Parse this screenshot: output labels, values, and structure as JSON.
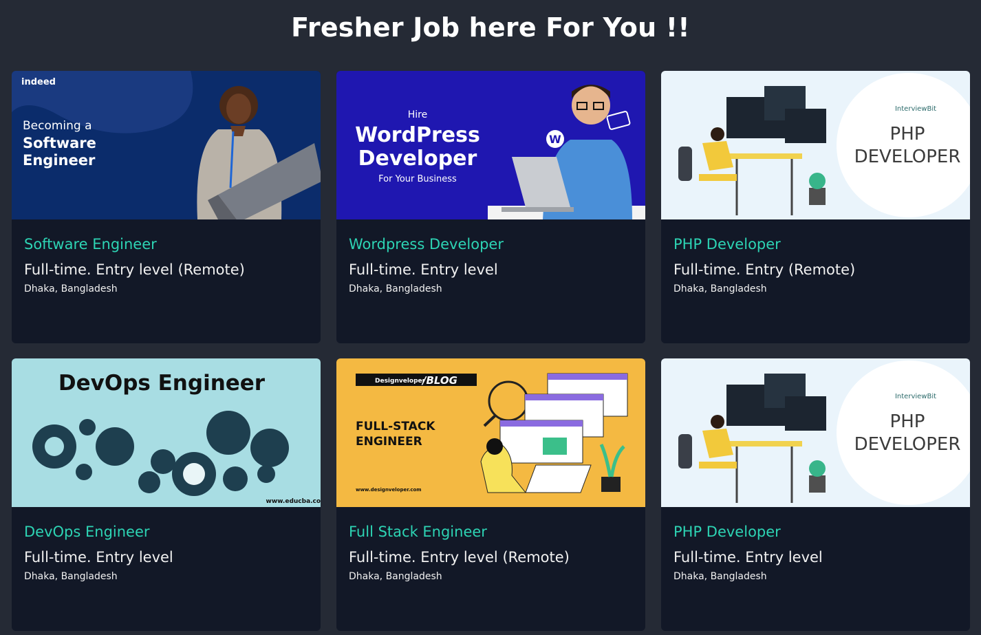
{
  "page": {
    "title": "Fresher Job here For You !!"
  },
  "colors": {
    "background": "#252a35",
    "card": "#121827",
    "accent_title": "#2dd4b4",
    "text": "#f1f1f1"
  },
  "jobs": [
    {
      "title": "Software Engineer",
      "type": "Full-time. Entry level (Remote)",
      "location": "Dhaka, Bangladesh",
      "image": {
        "brand": "indeed",
        "line1": "Becoming a",
        "line2": "Software",
        "line3": "Engineer"
      }
    },
    {
      "title": "Wordpress Developer",
      "type": "Full-time. Entry level",
      "location": "Dhaka, Bangladesh",
      "image": {
        "line0": "Hire",
        "line1": "WordPress",
        "line2": "Developer",
        "line3": "For Your Business"
      }
    },
    {
      "title": "PHP Developer",
      "type": "Full-time. Entry (Remote)",
      "location": "Dhaka, Bangladesh",
      "image": {
        "brand": "InterviewBit",
        "line1": "PHP",
        "line2": "DEVELOPER"
      }
    },
    {
      "title": "DevOps Engineer",
      "type": "Full-time. Entry level",
      "location": "Dhaka, Bangladesh",
      "image": {
        "headline": "DevOps Engineer",
        "site": "www.educba.com"
      }
    },
    {
      "title": "Full Stack Engineer",
      "type": "Full-time. Entry level (Remote)",
      "location": "Dhaka, Bangladesh",
      "image": {
        "brand": "Designveloper",
        "tag": "/BLOG",
        "line1": "FULL-STACK",
        "line2": "ENGINEER",
        "site": "www.designveloper.com"
      }
    },
    {
      "title": "PHP Developer",
      "type": "Full-time. Entry level",
      "location": "Dhaka, Bangladesh",
      "image": {
        "brand": "InterviewBit",
        "line1": "PHP",
        "line2": "DEVELOPER"
      }
    }
  ]
}
